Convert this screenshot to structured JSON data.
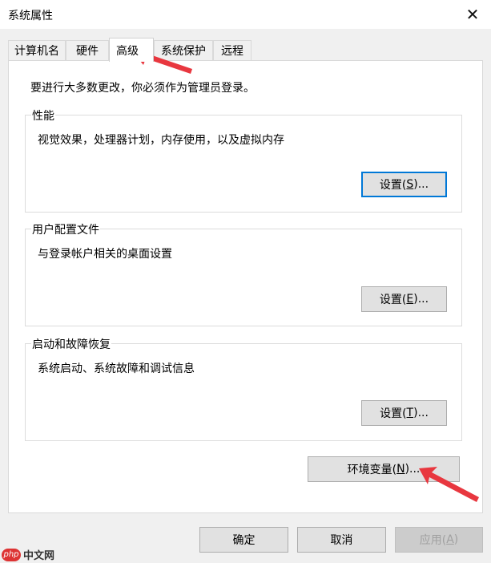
{
  "window": {
    "title": "系统属性",
    "close_glyph": "✕"
  },
  "tabs": [
    {
      "label": "计算机名"
    },
    {
      "label": "硬件"
    },
    {
      "label": "高级",
      "active": true
    },
    {
      "label": "系统保护"
    },
    {
      "label": "远程"
    }
  ],
  "advanced": {
    "admin_note": "要进行大多数更改，你必须作为管理员登录。",
    "performance": {
      "title": "性能",
      "description": "视觉效果，处理器计划，内存使用，以及虚拟内存",
      "button": {
        "prefix": "设置(",
        "key": "S",
        "suffix": ")..."
      }
    },
    "user_profiles": {
      "title": "用户配置文件",
      "description": "与登录帐户相关的桌面设置",
      "button": {
        "prefix": "设置(",
        "key": "E",
        "suffix": ")..."
      }
    },
    "startup_recovery": {
      "title": "启动和故障恢复",
      "description": "系统启动、系统故障和调试信息",
      "button": {
        "prefix": "设置(",
        "key": "T",
        "suffix": ")..."
      }
    },
    "env_button": {
      "prefix": "环境变量(",
      "key": "N",
      "suffix": ")..."
    }
  },
  "footer": {
    "ok": "确定",
    "cancel": "取消",
    "apply": {
      "prefix": "应用(",
      "key": "A",
      "suffix": ")"
    }
  },
  "watermark": {
    "logo": "php",
    "text": "中文网"
  },
  "colors": {
    "annotation_arrow": "#e8373f",
    "focus": "#0078d7"
  }
}
